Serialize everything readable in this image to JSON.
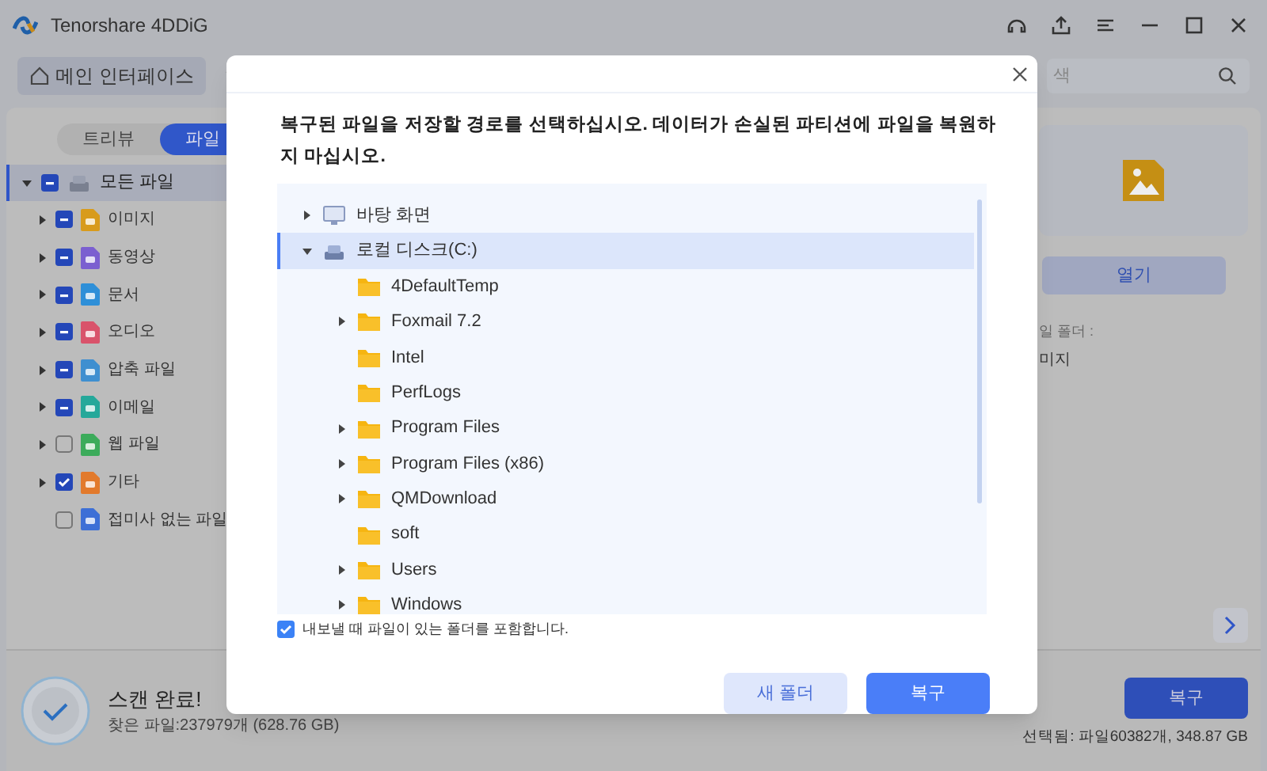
{
  "window": {
    "title": "Tenorshare 4DDiG"
  },
  "toolbar": {
    "home_button": "메인 인터페이스",
    "search": {
      "placeholder": "색"
    }
  },
  "view_tabs": [
    {
      "label": "트리뷰",
      "selected": false
    },
    {
      "label": "파일",
      "selected": true
    }
  ],
  "sidebar": {
    "items": [
      {
        "label": "모든 파일",
        "checked": false,
        "partial": true,
        "selected": true,
        "expanded": true,
        "children": [
          {
            "label": "이미지",
            "checked": false,
            "partial": true,
            "color": "#d89b1c",
            "expandable": true
          },
          {
            "label": "동영상",
            "checked": false,
            "partial": true,
            "color": "#7b5fd0",
            "expandable": true
          },
          {
            "label": "문서",
            "checked": false,
            "partial": true,
            "color": "#2e8fd8",
            "expandable": true
          },
          {
            "label": "오디오",
            "checked": false,
            "partial": true,
            "color": "#d9536b",
            "expandable": true
          },
          {
            "label": "압축 파일",
            "checked": false,
            "partial": true,
            "color": "#3f8fd0",
            "expandable": true
          },
          {
            "label": "이메일",
            "checked": false,
            "partial": true,
            "color": "#25a89a",
            "expandable": true
          },
          {
            "label": "웹 파일",
            "checked": false,
            "partial": false,
            "color": "#3cab5b",
            "expandable": true
          },
          {
            "label": "기타",
            "checked": true,
            "partial": false,
            "color": "#e27a2c",
            "expandable": true
          },
          {
            "label": "접미사 없는 파일",
            "checked": false,
            "partial": false,
            "color": "#3d6fd6",
            "expandable": false
          }
        ]
      }
    ]
  },
  "preview": {
    "open_button": "열기",
    "folder_label": "일 폴더 :",
    "folder_value": "미지"
  },
  "dialog": {
    "message": "복구된 파일을 저장할 경로를 선택하십시오. 데이터가 손실된 파티션에 파일을 복원하지 마십시오.",
    "tree": [
      {
        "label": "바탕 화면",
        "kind": "desktop",
        "expanded": false,
        "selected": false
      },
      {
        "label": "로컬 디스크(C:)",
        "kind": "disk",
        "expanded": true,
        "selected": true,
        "children": [
          {
            "label": "4DefaultTemp",
            "expandable": false
          },
          {
            "label": "Foxmail 7.2",
            "expandable": true
          },
          {
            "label": "Intel",
            "expandable": false
          },
          {
            "label": "PerfLogs",
            "expandable": false
          },
          {
            "label": "Program Files",
            "expandable": true
          },
          {
            "label": "Program Files (x86)",
            "expandable": true
          },
          {
            "label": "QMDownload",
            "expandable": true
          },
          {
            "label": "soft",
            "expandable": false
          },
          {
            "label": "Users",
            "expandable": true
          },
          {
            "label": "Windows",
            "expandable": true
          }
        ]
      }
    ],
    "include_folder": {
      "label": "내보낼 때 파일이 있는 폴더를 포함합니다.",
      "checked": true
    },
    "buttons": [
      {
        "label": "새 폴더",
        "kind": "secondary"
      },
      {
        "label": "복구",
        "kind": "primary"
      }
    ]
  },
  "status": {
    "title": "스캔 완료!",
    "found": "찾은 파일:237979개 (628.76 GB)",
    "recover_button": "복구",
    "selected": "선택됨: 파일60382개, 348.87 GB"
  }
}
